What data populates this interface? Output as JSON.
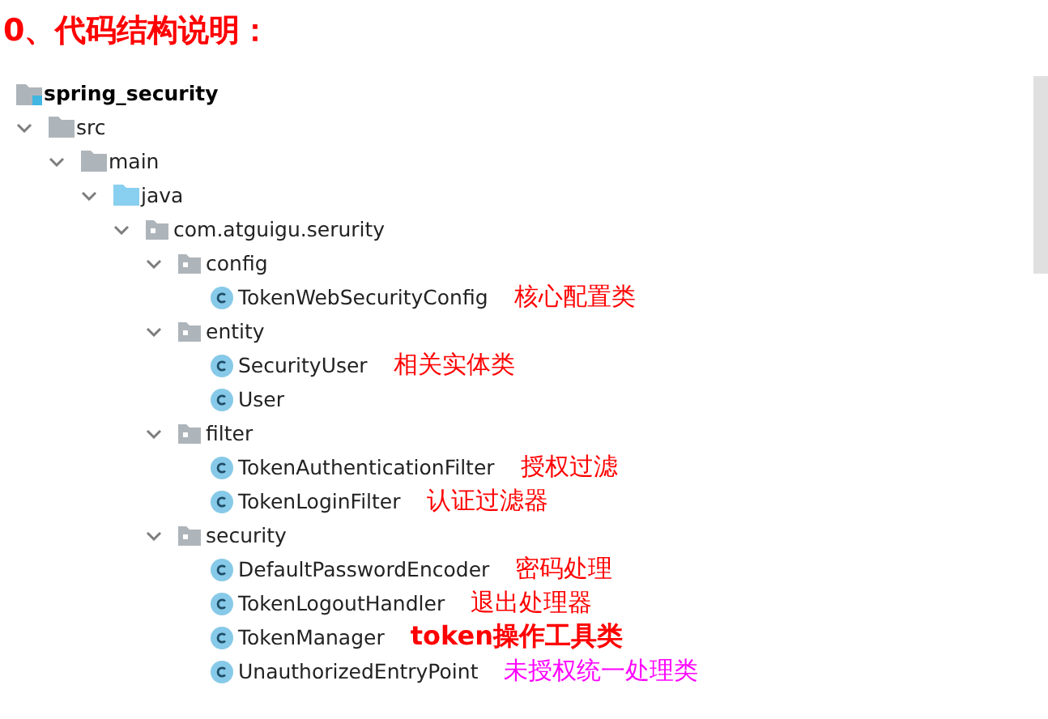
{
  "heading": "0、代码结构说明：",
  "tree": {
    "label": "spring_security",
    "kind": "module",
    "children": [
      {
        "label": "src",
        "kind": "folder",
        "expanded": true,
        "children": [
          {
            "label": "main",
            "kind": "folder",
            "expanded": true,
            "children": [
              {
                "label": "java",
                "kind": "source_folder",
                "expanded": true,
                "children": [
                  {
                    "label": "com.atguigu.serurity",
                    "kind": "package",
                    "expanded": true,
                    "children": [
                      {
                        "label": "config",
                        "kind": "package",
                        "expanded": true,
                        "children": [
                          {
                            "label": "TokenWebSecurityConfig",
                            "kind": "class",
                            "note": {
                              "text": "核心配置类",
                              "color": "#ff0000",
                              "emphasis": false
                            }
                          }
                        ]
                      },
                      {
                        "label": "entity",
                        "kind": "package",
                        "expanded": true,
                        "children": [
                          {
                            "label": "SecurityUser",
                            "kind": "class",
                            "note": {
                              "text": "相关实体类",
                              "color": "#ff0000",
                              "emphasis": false
                            }
                          },
                          {
                            "label": "User",
                            "kind": "class"
                          }
                        ]
                      },
                      {
                        "label": "filter",
                        "kind": "package",
                        "expanded": true,
                        "children": [
                          {
                            "label": "TokenAuthenticationFilter",
                            "kind": "class",
                            "note": {
                              "text": "授权过滤",
                              "color": "#ff0000",
                              "emphasis": false
                            }
                          },
                          {
                            "label": "TokenLoginFilter",
                            "kind": "class",
                            "note": {
                              "text": "认证过滤器",
                              "color": "#ff0000",
                              "emphasis": false
                            }
                          }
                        ]
                      },
                      {
                        "label": "security",
                        "kind": "package",
                        "expanded": true,
                        "children": [
                          {
                            "label": "DefaultPasswordEncoder",
                            "kind": "class",
                            "note": {
                              "text": "密码处理",
                              "color": "#ff0000",
                              "emphasis": false
                            }
                          },
                          {
                            "label": "TokenLogoutHandler",
                            "kind": "class",
                            "note": {
                              "text": "退出处理器",
                              "color": "#ff0000",
                              "emphasis": false
                            }
                          },
                          {
                            "label": "TokenManager",
                            "kind": "class",
                            "note": {
                              "text": "token操作工具类",
                              "color": "#ff0000",
                              "emphasis": true
                            }
                          },
                          {
                            "label": "UnauthorizedEntryPoint",
                            "kind": "class",
                            "note": {
                              "text": "未授权统一处理类",
                              "color": "#ff00ff",
                              "emphasis": false
                            }
                          }
                        ]
                      }
                    ]
                  }
                ]
              }
            ]
          }
        ]
      }
    ]
  }
}
